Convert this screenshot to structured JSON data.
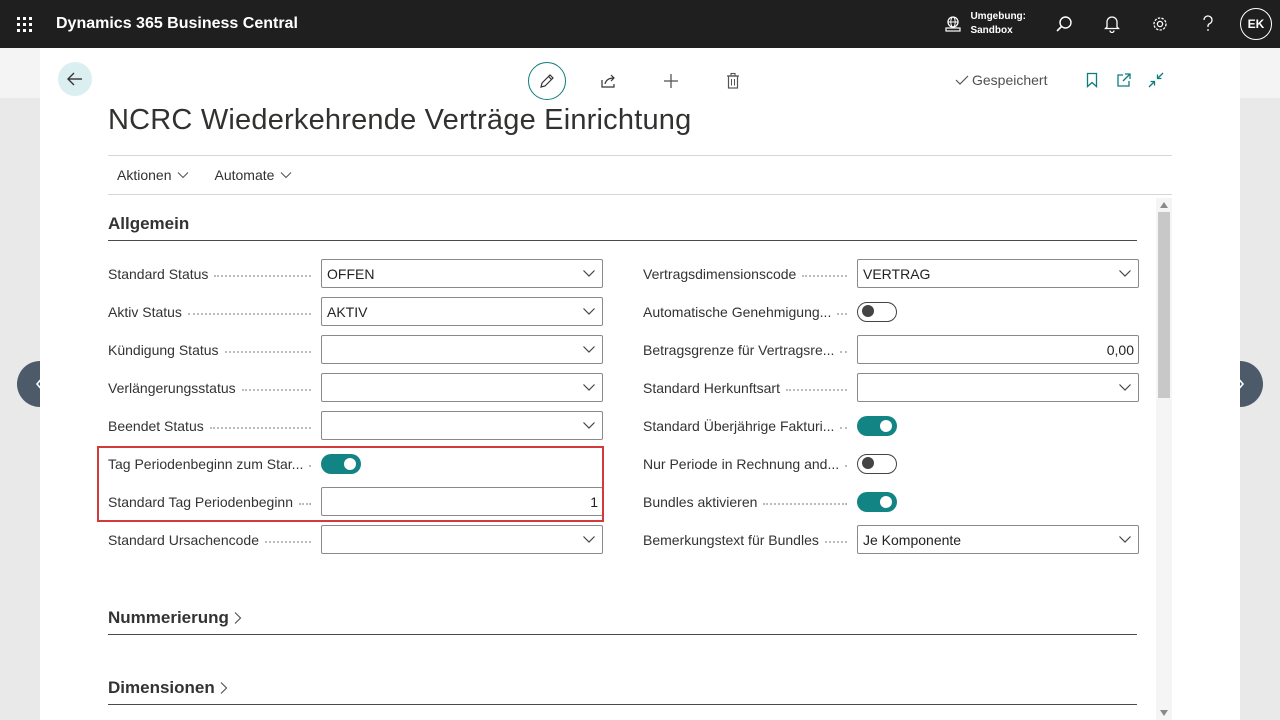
{
  "app": {
    "title": "Dynamics 365 Business Central"
  },
  "topbar": {
    "env_label": "Umgebung:",
    "env_value": "Sandbox",
    "user_initials": "EK"
  },
  "page": {
    "title": "NCRC Wiederkehrende Verträge Einrichtung",
    "saved_status": "Gespeichert"
  },
  "actions": [
    {
      "label": "Aktionen"
    },
    {
      "label": "Automate"
    }
  ],
  "sections": {
    "general": "Allgemein",
    "numbering": "Nummerierung",
    "dimensions": "Dimensionen"
  },
  "left_fields": [
    {
      "label": "Standard Status",
      "type": "select",
      "value": "OFFEN"
    },
    {
      "label": "Aktiv Status",
      "type": "select",
      "value": "AKTIV"
    },
    {
      "label": "Kündigung Status",
      "type": "select",
      "value": ""
    },
    {
      "label": "Verlängerungsstatus",
      "type": "select",
      "value": ""
    },
    {
      "label": "Beendet Status",
      "type": "select",
      "value": ""
    },
    {
      "label": "Tag Periodenbeginn zum Star...",
      "type": "toggle",
      "on": true
    },
    {
      "label": "Standard Tag Periodenbeginn",
      "type": "number",
      "value": "1"
    },
    {
      "label": "Standard Ursachencode",
      "type": "select",
      "value": ""
    }
  ],
  "right_fields": [
    {
      "label": "Vertragsdimensionscode",
      "type": "select",
      "value": "VERTRAG"
    },
    {
      "label": "Automatische Genehmigung...",
      "type": "toggle",
      "on": false
    },
    {
      "label": "Betragsgrenze für Vertragsre...",
      "type": "number",
      "value": "0,00"
    },
    {
      "label": "Standard Herkunftsart",
      "type": "select",
      "value": ""
    },
    {
      "label": "Standard Überjährige Fakturi...",
      "type": "toggle",
      "on": true
    },
    {
      "label": "Nur Periode in Rechnung and...",
      "type": "toggle",
      "on": false
    },
    {
      "label": "Bundles aktivieren",
      "type": "toggle",
      "on": true
    },
    {
      "label": "Bemerkungstext für Bundles",
      "type": "select",
      "value": "Je Komponente"
    }
  ],
  "colors": {
    "accent": "#138484",
    "highlight": "#d33b3b",
    "topbar": "#1f1f1f"
  },
  "icons": [
    "waffle-icon",
    "environment-icon",
    "search-icon",
    "bell-icon",
    "gear-icon",
    "help-icon",
    "back-arrow-icon",
    "pencil-icon",
    "share-icon",
    "plus-icon",
    "trash-icon",
    "check-icon",
    "bookmark-icon",
    "open-new-window-icon",
    "collapse-icon",
    "chevron-down-icon",
    "chevron-right-icon",
    "chevron-left-icon"
  ]
}
